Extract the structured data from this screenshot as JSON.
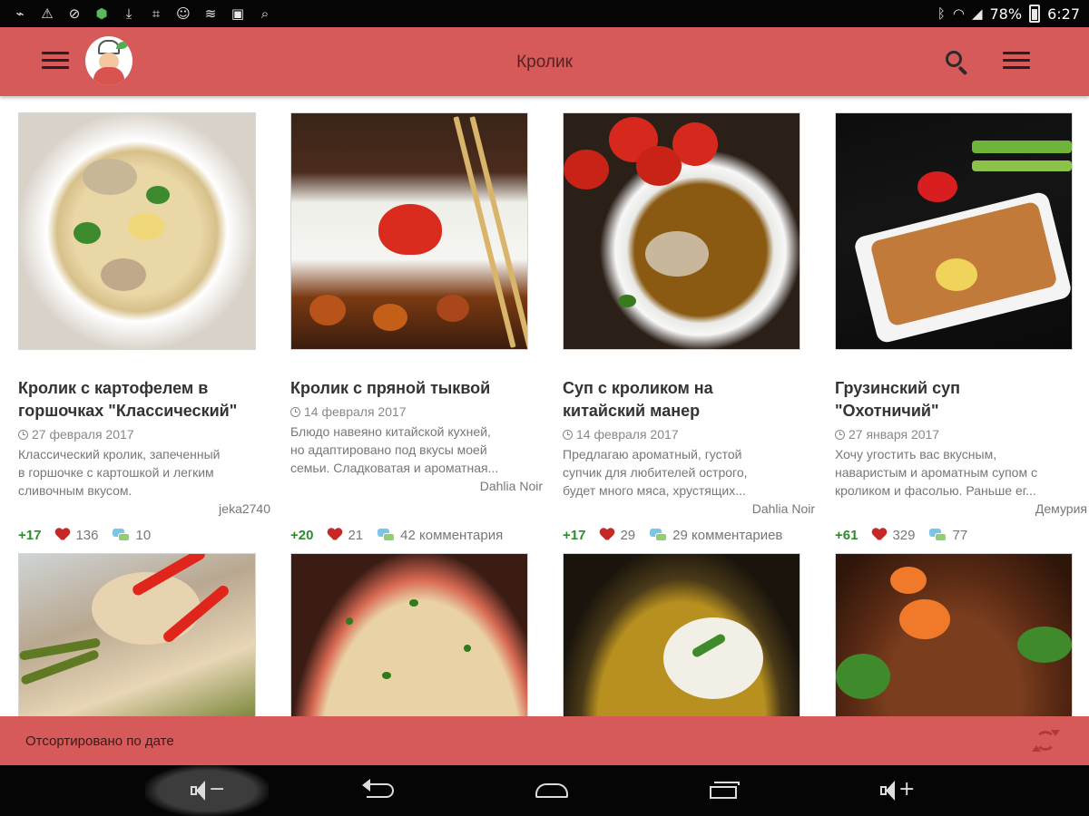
{
  "status_bar": {
    "battery": "78%",
    "time": "6:27",
    "left_icons": [
      "usb-debug-icon",
      "warning-icon",
      "blocked-icon",
      "shield-icon",
      "download-icon",
      "wifi-tool-icon",
      "person-icon",
      "wifi-signal-icon",
      "image-icon",
      "search-icon"
    ],
    "right_icons": [
      "bluetooth-icon",
      "wifi-icon",
      "signal-icon",
      "battery-icon"
    ]
  },
  "app_bar": {
    "title": "Кролик",
    "color": "#d65a5a"
  },
  "cards": [
    {
      "title": "Кролик с картофелем в\nгоршочках \"Классический\"",
      "date": "27 февраля 2017",
      "description": "Классический кролик, запеченный\nв горшочке с картошкой и легким\nсливочным вкусом.",
      "author": "jeka2740",
      "rating": "+17",
      "likes": "136",
      "comments": "10"
    },
    {
      "title": "Кролик с пряной тыквой",
      "date": "14 февраля 2017",
      "description": "Блюдо навеяно китайской кухней,\nно адаптировано под вкусы моей\nсемьи. Сладковатая и ароматная...",
      "author": "Dahlia Noir",
      "rating": "+20",
      "likes": "21",
      "comments": "42 комментария"
    },
    {
      "title": "Суп с кроликом на\nкитайский манер",
      "date": "14 февраля 2017",
      "description": "Предлагаю ароматный, густой\nсупчик для любителей острого,\nбудет много мяса, хрустящих...",
      "author": "Dahlia Noir",
      "rating": "+17",
      "likes": "29",
      "comments": "29 комментариев"
    },
    {
      "title": "Грузинский суп\n\"Охотничий\"",
      "date": "27 января 2017",
      "description": "Хочу угостить вас вкусным,\nнаваристым и ароматным супом с\nкроликом и фасолью. Раньше ег...",
      "author": "Демурия",
      "rating": "+61",
      "likes": "329",
      "comments": "77"
    }
  ],
  "sort_bar": {
    "label": "Отсортировано по дате"
  },
  "nav_bar": {
    "vol_down": "−",
    "vol_up": "+"
  },
  "colors": {
    "accent": "#d65a5a",
    "rating_green": "#2f8a2f",
    "heart_red": "#c62828"
  }
}
